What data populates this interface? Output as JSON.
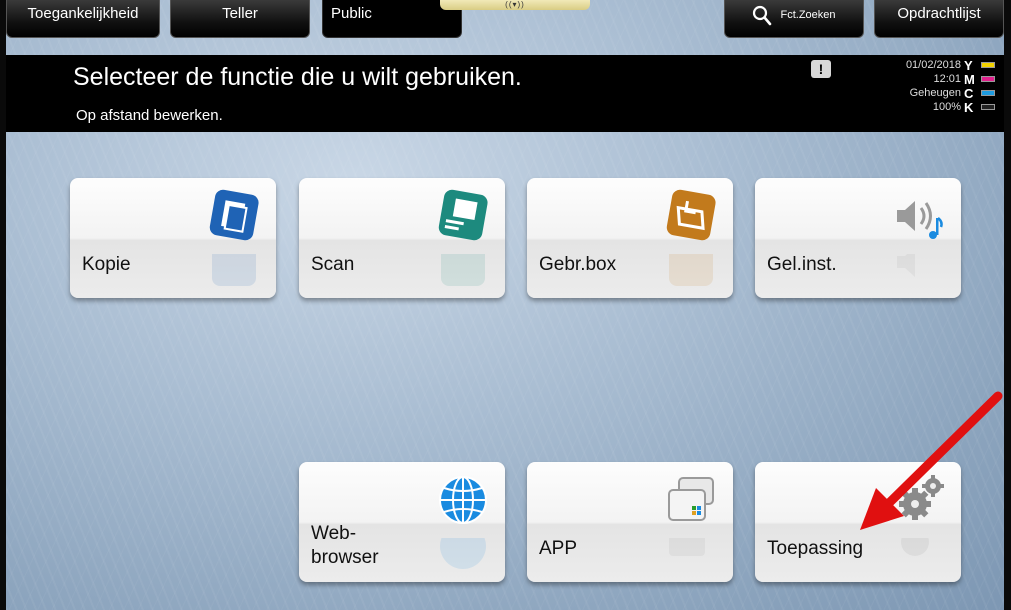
{
  "tabs": {
    "accessibility": "Toegankelijkheid",
    "counter": "Teller",
    "public": "Public",
    "search": "Fct.Zoeken",
    "job_list": "Opdrachtlijst",
    "notch": "((▾))"
  },
  "header": {
    "title": "Selecteer de functie die u wilt gebruiken.",
    "subtitle": "Op afstand bewerken.",
    "alert": "!",
    "date": "01/02/2018",
    "time": "12:01",
    "memory_label": "Geheugen",
    "memory_value": "100%"
  },
  "toner": [
    {
      "letter": "Y",
      "color": "#f2d200"
    },
    {
      "letter": "M",
      "color": "#e0208c"
    },
    {
      "letter": "C",
      "color": "#1e9be0"
    },
    {
      "letter": "K",
      "color": "#222222"
    }
  ],
  "tiles": {
    "copy": "Kopie",
    "scan": "Scan",
    "user_box": "Gebr.box",
    "sound_settings": "Gel.inst.",
    "web_browser_line1": "Web-",
    "web_browser_line2": "browser",
    "app": "APP",
    "application": "Toepassing"
  },
  "colors": {
    "copy_icon": "#1f63b5",
    "scan_icon": "#1d8a7e",
    "box_icon": "#c27a1c",
    "globe_icon": "#1a8be0",
    "arrow": "#e01010"
  }
}
